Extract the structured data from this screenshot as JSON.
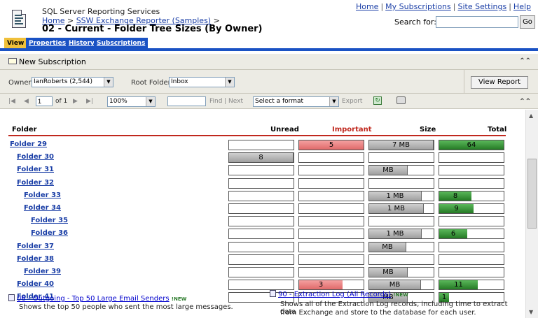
{
  "header": {
    "app_name": "SQL Server Reporting Services",
    "breadcrumb": {
      "home": "Home",
      "sep1": ">",
      "folder": "SSW Exchange Reporter (Samples)",
      "sep2": ">"
    },
    "title": "02 - Current - Folder Tree Sizes (By Owner)",
    "links": [
      "Home",
      "My Subscriptions",
      "Site Settings",
      "Help"
    ],
    "search_label": "Search for:",
    "search_value": "",
    "go_label": "Go"
  },
  "tabs": [
    "View",
    "Properties",
    "History",
    "Subscriptions"
  ],
  "subscription_bar": {
    "label": "New Subscription"
  },
  "params": {
    "owner_label": "Owner",
    "owner_value": "IanRoberts (2,544)",
    "root_folder_label": "Root Folder",
    "root_folder_value": "Inbox",
    "view_report_label": "View Report"
  },
  "toolbar": {
    "page_value": "1",
    "of_label": "of 1",
    "zoom_value": "100%",
    "find_value": "",
    "find_label": "Find",
    "sep": "|",
    "next_label": "Next",
    "format_value": "Select a format",
    "export_label": "Export"
  },
  "report": {
    "columns": [
      "Folder",
      "Unread",
      "Important",
      "Size",
      "Total"
    ],
    "colors": {
      "header_rule": "#c0281e",
      "important_header": "#c0281e",
      "link": "#1a3ea6"
    },
    "rows": [
      {
        "name": "Folder 29",
        "level": 0,
        "unread": null,
        "important": {
          "label": "5",
          "fill": 1.0
        },
        "size": {
          "label": "7 MB",
          "fill": 1.0
        },
        "total": {
          "label": "64",
          "fill": 1.0
        }
      },
      {
        "name": "Folder 30",
        "level": 1,
        "unread": {
          "label": "8",
          "fill": 1.0
        },
        "important": null,
        "size": null,
        "total": null
      },
      {
        "name": "Folder 31",
        "level": 1,
        "unread": null,
        "important": null,
        "size": {
          "label": "MB",
          "fill": 0.6
        },
        "total": null
      },
      {
        "name": "Folder 32",
        "level": 1,
        "unread": null,
        "important": null,
        "size": null,
        "total": null
      },
      {
        "name": "Folder 33",
        "level": 2,
        "unread": null,
        "important": null,
        "size": {
          "label": "1 MB",
          "fill": 0.82
        },
        "total": {
          "label": "8",
          "fill": 0.5
        }
      },
      {
        "name": "Folder 34",
        "level": 2,
        "unread": null,
        "important": null,
        "size": {
          "label": "1 MB",
          "fill": 0.85
        },
        "total": {
          "label": "9",
          "fill": 0.53
        }
      },
      {
        "name": "Folder 35",
        "level": 3,
        "unread": null,
        "important": null,
        "size": null,
        "total": null
      },
      {
        "name": "Folder 36",
        "level": 3,
        "unread": null,
        "important": null,
        "size": {
          "label": "1 MB",
          "fill": 0.82
        },
        "total": {
          "label": "6",
          "fill": 0.43
        }
      },
      {
        "name": "Folder 37",
        "level": 1,
        "unread": null,
        "important": null,
        "size": {
          "label": "MB",
          "fill": 0.58
        },
        "total": null
      },
      {
        "name": "Folder 38",
        "level": 1,
        "unread": null,
        "important": null,
        "size": null,
        "total": null
      },
      {
        "name": "Folder 39",
        "level": 2,
        "unread": null,
        "important": null,
        "size": {
          "label": "MB",
          "fill": 0.6
        },
        "total": null
      },
      {
        "name": "Folder 40",
        "level": 1,
        "unread": null,
        "important": {
          "label": "3",
          "fill": 0.67
        },
        "size": {
          "label": "MB",
          "fill": 0.8
        },
        "total": {
          "label": "11",
          "fill": 0.6
        }
      },
      {
        "name": "Folder 41",
        "level": 1,
        "unread": null,
        "important": null,
        "size": {
          "label": "MB",
          "fill": 0.6
        },
        "total": {
          "label": "1",
          "fill": 0.15
        }
      }
    ]
  },
  "overlay": {
    "item1_title": "06 - Outgoing - Top 50 Large Email Senders",
    "item1_new": "!NEW",
    "item1_desc": "Shows the top 50 people who sent the most large messages.",
    "item2_title": "90 - Extraction Log (All Records)",
    "item2_new": "!NEW",
    "item2_desc_line1": "Shows all of the Extraction Log records, including time to extract data",
    "item2_desc_line2": "from Exchange and store to the database for each user."
  }
}
